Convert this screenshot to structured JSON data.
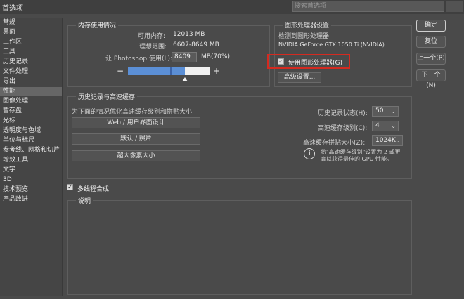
{
  "window": {
    "title": "首选项",
    "search_placeholder": "搜索首选项"
  },
  "sidebar": {
    "items": [
      {
        "label": "常规"
      },
      {
        "label": "界面"
      },
      {
        "label": "工作区"
      },
      {
        "label": "工具"
      },
      {
        "label": "历史记录"
      },
      {
        "label": "文件处理"
      },
      {
        "label": "导出"
      },
      {
        "label": "性能",
        "selected": true
      },
      {
        "label": "图像处理"
      },
      {
        "label": "暂存盘"
      },
      {
        "label": "光标"
      },
      {
        "label": "透明度与色域"
      },
      {
        "label": "单位与标尺"
      },
      {
        "label": "参考线、网格和切片"
      },
      {
        "label": "增效工具"
      },
      {
        "label": "文字"
      },
      {
        "label": "3D"
      },
      {
        "label": "技术预览"
      },
      {
        "label": "产品改进"
      }
    ]
  },
  "memory": {
    "title": "内存使用情况",
    "available_label": "可用内存:",
    "available_value": "12013 MB",
    "ideal_label": "理想范围:",
    "ideal_value": "6607-8649 MB",
    "let_label": "让 Photoshop 使用(L):",
    "let_value": "8409",
    "let_unit": "MB(70%)",
    "minus": "−",
    "plus": "+",
    "usage_fraction": 0.7
  },
  "gpu": {
    "title": "图形处理器设置",
    "detected_label": "检测到图形处理器:",
    "gpu_name": "NVIDIA GeForce GTX 1050 Ti (NVIDIA)",
    "use_gpu_label": "使用图形处理器(G)",
    "use_gpu_checked": true,
    "advanced_button": "高级设置..."
  },
  "history_cache": {
    "title": "历史记录与高速缓存",
    "optimize_label": "为下面的情况优化高速缓存级别和拼贴大小:",
    "buttons": [
      "Web / 用户界面设计",
      "默认 / 照片",
      "超大像素大小"
    ],
    "history_states_label": "历史记录状态(H):",
    "history_states_value": "50",
    "cache_levels_label": "高速缓存级别(C):",
    "cache_levels_value": "4",
    "tile_size_label": "高速缓存拼贴大小(Z):",
    "tile_size_value": "1024K",
    "info_icon": "i",
    "info_text_1": "将\"高速缓存级别\"设置为 2 或更",
    "info_text_2": "高以获得最佳的 GPU 性能。"
  },
  "multithread": {
    "label": "多线程合成",
    "checked": true
  },
  "description": {
    "title": "说明"
  },
  "actions": {
    "ok": "确定",
    "reset": "复位",
    "prev": "上一个(P)",
    "next": "下一个(N)"
  }
}
